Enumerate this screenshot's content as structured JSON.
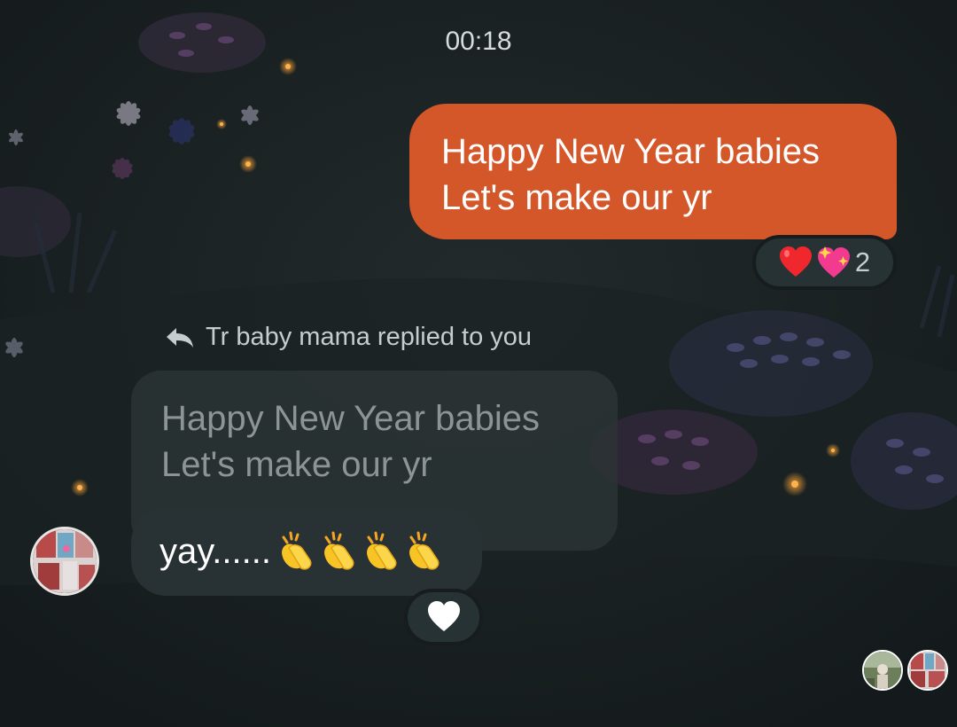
{
  "chat": {
    "timestamp": "00:18",
    "outgoing_message": {
      "line1": "Happy New Year babies",
      "line2": "Let's make our yr",
      "reactions": [
        "heart-emoji",
        "sparkling-heart-emoji"
      ],
      "reaction_count": "2"
    },
    "reply_note": {
      "icon": "reply-arrow-icon",
      "text": "Tr baby mama replied to you"
    },
    "quoted_message": {
      "line1": "Happy New Year babies",
      "line2": "Let's make our yr"
    },
    "incoming_message": {
      "text": "yay......",
      "emojis": [
        "clapping-hands",
        "clapping-hands",
        "clapping-hands",
        "clapping-hands"
      ],
      "reaction": "white-heart-emoji"
    }
  },
  "colors": {
    "background": "#171d1e",
    "outgoing_bubble": "#d4572a",
    "incoming_bubble": "#283133",
    "quoted_text": "#8d9496"
  }
}
